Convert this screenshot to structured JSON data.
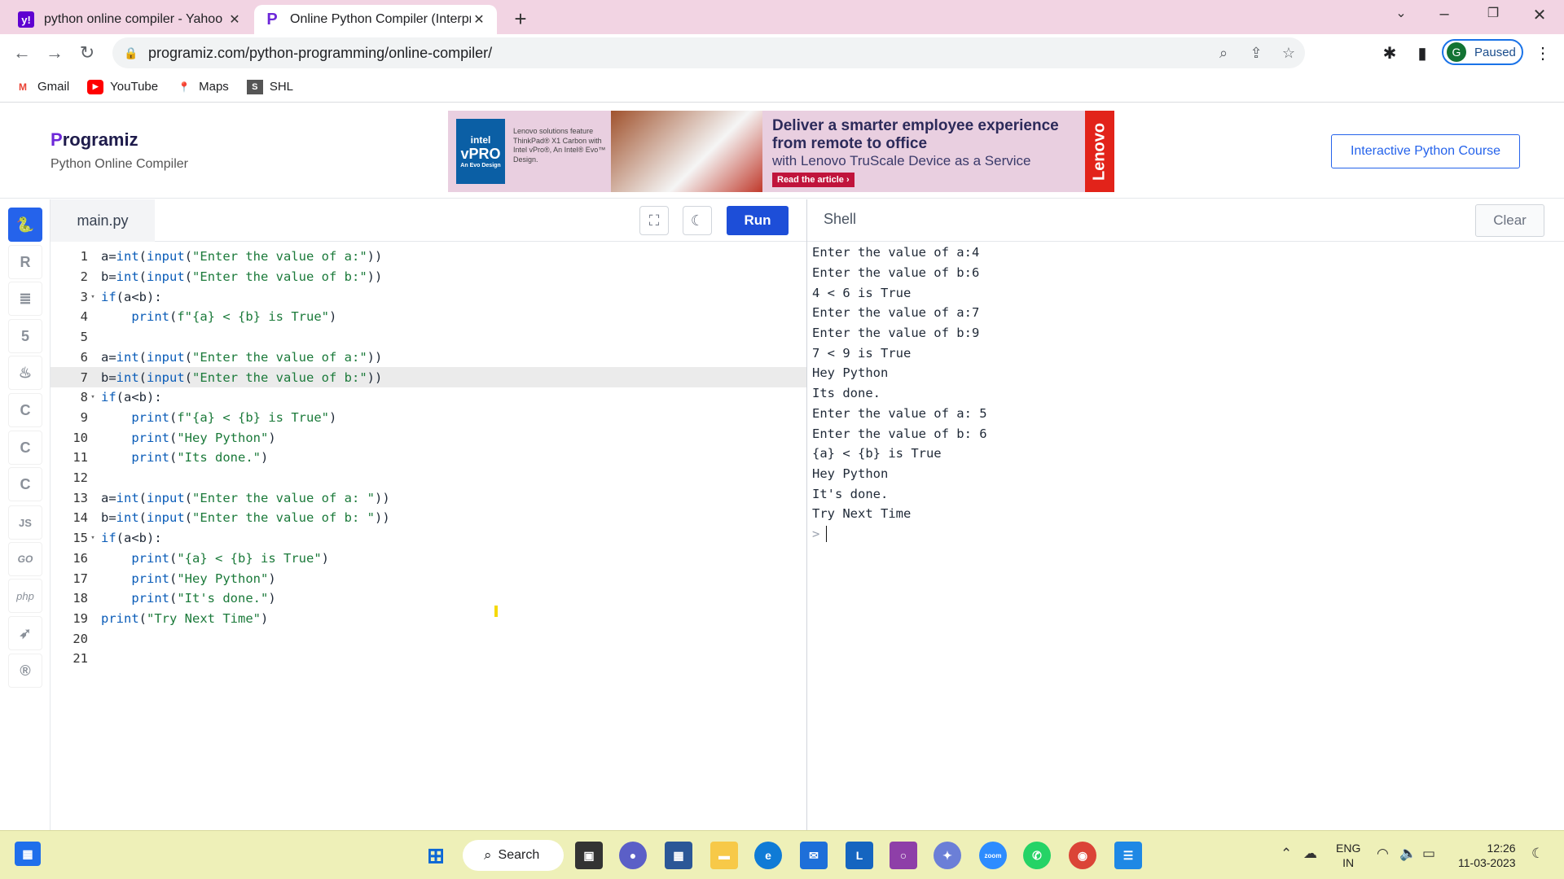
{
  "browser": {
    "tabs": [
      {
        "title": "python online compiler - Yahoo S",
        "favicon": "yahoo-icon",
        "active": false
      },
      {
        "title": "Online Python Compiler (Interpre",
        "favicon": "programiz-icon",
        "active": true
      }
    ],
    "url": "programiz.com/python-programming/online-compiler/",
    "profile_initial": "G",
    "profile_status": "Paused",
    "bookmarks": [
      {
        "label": "Gmail",
        "icon": "gmail-icon"
      },
      {
        "label": "YouTube",
        "icon": "youtube-icon"
      },
      {
        "label": "Maps",
        "icon": "maps-icon"
      },
      {
        "label": "SHL",
        "icon": "shl-icon"
      }
    ]
  },
  "site": {
    "brand": "rogramiz",
    "brand_initial": "P",
    "subtitle": "Python Online Compiler",
    "course_button": "Interactive Python Course",
    "ad": {
      "intel_top": "intel",
      "intel_mid": "vPRO",
      "intel_bottom": "An Evo Design",
      "copy": "Lenovo solutions feature ThinkPad® X1 Carbon with Intel vPro®, An Intel® Evo™ Design.",
      "headline": "Deliver a smarter employee experience from remote to office",
      "subline": "with Lenovo TruScale Device as a Service",
      "cta": "Read the article ›",
      "brand": "Lenovo"
    }
  },
  "rail": [
    "python-icon",
    "r-icon",
    "sql-icon",
    "html-icon",
    "java-icon",
    "c-icon",
    "cpp-icon",
    "csharp-icon",
    "js-icon",
    "go-icon",
    "php-icon",
    "swift-icon",
    "rust-icon"
  ],
  "rail_labels": {
    "js": "JS",
    "go": "GO",
    "php": "php"
  },
  "editor": {
    "file_name": "main.py",
    "run_label": "Run",
    "lines": [
      "a=int(input(\"Enter the value of a:\"))",
      "b=int(input(\"Enter the value of b:\"))",
      "if(a<b):",
      "    print(f\"{a} < {b} is True\")",
      "",
      "a=int(input(\"Enter the value of a:\"))",
      "b=int(input(\"Enter the value of b:\"))",
      "if(a<b):",
      "    print(f\"{a} < {b} is True\")",
      "    print(\"Hey Python\")",
      "    print(\"Its done.\")",
      "",
      "a=int(input(\"Enter the value of a: \"))",
      "b=int(input(\"Enter the value of b: \"))",
      "if(a<b):",
      "    print(\"{a} < {b} is True\")",
      "    print(\"Hey Python\")",
      "    print(\"It's done.\")",
      "print(\"Try Next Time\")",
      "",
      ""
    ],
    "highlighted_line": 7,
    "foldable_lines": [
      3,
      8,
      15
    ]
  },
  "shell": {
    "title": "Shell",
    "clear_label": "Clear",
    "output": [
      "Enter the value of a:4",
      "Enter the value of b:6",
      "4 < 6 is True",
      "Enter the value of a:7",
      "Enter the value of b:9",
      "7 < 9 is True",
      "Hey Python",
      "Its done.",
      "Enter the value of a: 5",
      "Enter the value of b: 6",
      "{a} < {b} is True",
      "Hey Python",
      "It's done.",
      "Try Next Time"
    ],
    "prompt": ">"
  },
  "taskbar": {
    "search_label": "Search",
    "lang_top": "ENG",
    "lang_bottom": "IN",
    "time": "12:26",
    "date": "11-03-2023"
  },
  "colors": {
    "accent": "#2563eb",
    "run": "#1d4ed8",
    "tab_bar": "#f2d4e3",
    "taskbar": "#eef0b8"
  }
}
